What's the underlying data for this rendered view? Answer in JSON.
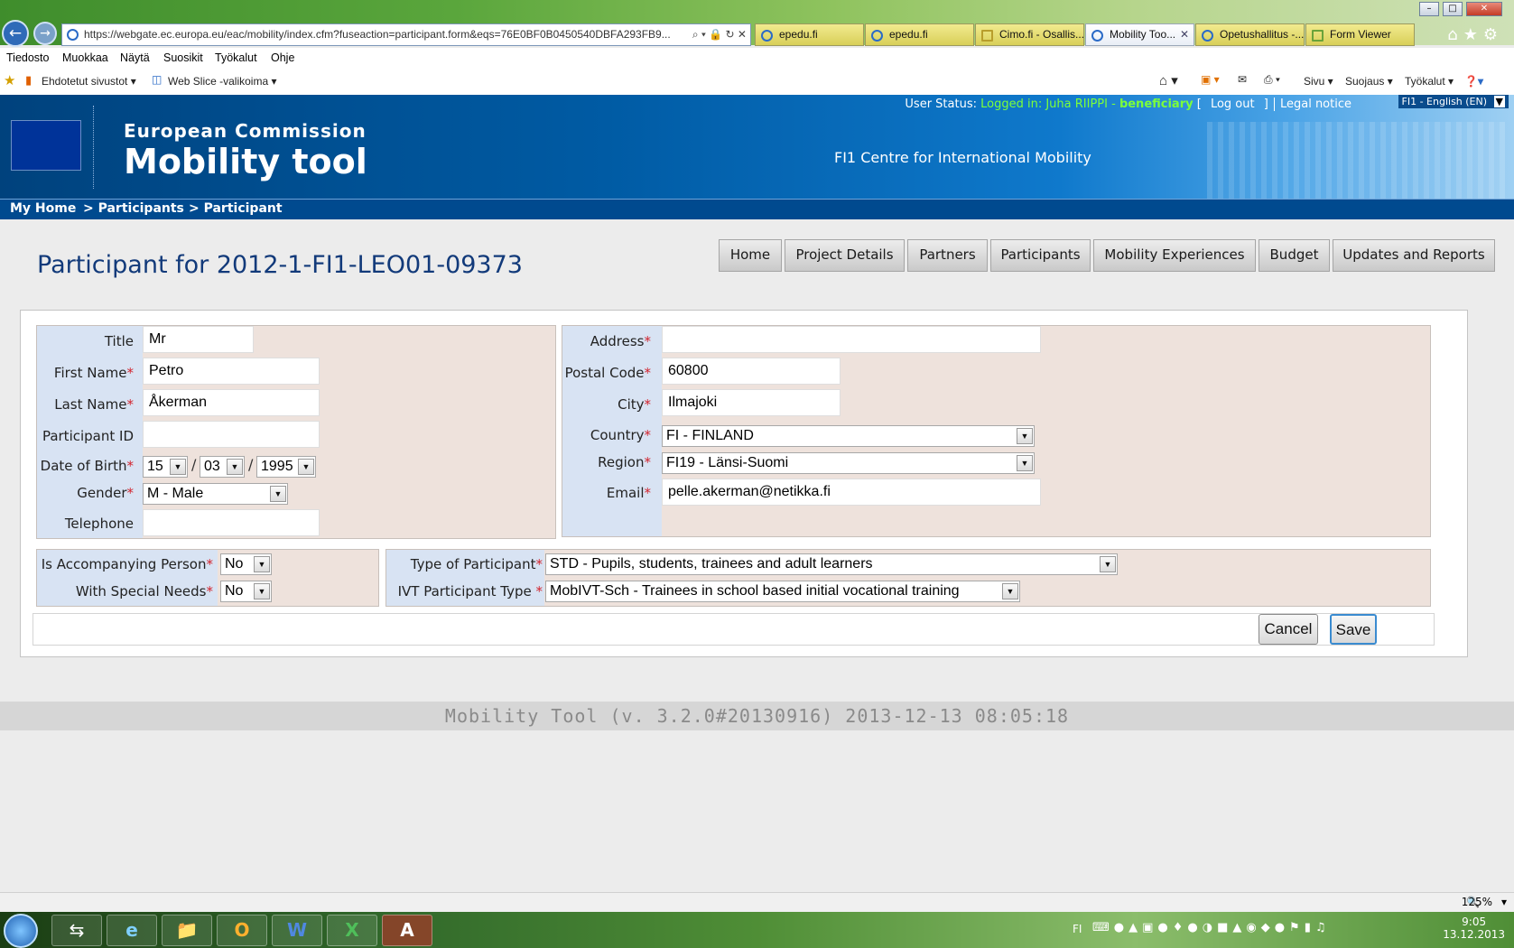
{
  "browser": {
    "url": "https://webgate.ec.europa.eu/eac/mobility/index.cfm?fuseaction=participant.form&eqs=76E0BF0B0450540DBFA293FB9...",
    "address_controls": "⌕ ▾ 🔒 ↻ ✕",
    "tabs": [
      {
        "label": "epedu.fi"
      },
      {
        "label": "epedu.fi"
      },
      {
        "label": "Cimo.fi - Osallis..."
      },
      {
        "label": "Mobility Too...",
        "close": "✕"
      },
      {
        "label": "Opetushallitus -..."
      },
      {
        "label": "Form Viewer"
      }
    ],
    "menu": [
      "Tiedosto",
      "Muokkaa",
      "Näytä",
      "Suosikit",
      "Työkalut",
      "Ohje"
    ],
    "favorites": {
      "item1": "Ehdotetut sivustot ▾",
      "item2": "Web Slice -valikoima ▾"
    },
    "command_bar": {
      "page": "Sivu ▾",
      "safety": "Suojaus ▾",
      "tools": "Työkalut ▾"
    },
    "zoom": "125%",
    "window_controls": {
      "minimize": "–",
      "maximize": "□",
      "close": "✕"
    }
  },
  "header": {
    "user_status_label": "User Status:",
    "logged_in_text": "Logged in: Juha RIIPPI -",
    "role": "beneficiary",
    "bracket_open": "[",
    "logout": "Log out",
    "bracket_close": "]",
    "legal_notice": "Legal notice",
    "language": "FI1 - English (EN)",
    "org_line1": "European Commission",
    "org_line2": "Mobility tool",
    "centre": "FI1 Centre for International Mobility"
  },
  "breadcrumb": [
    "My Home",
    "> Participants",
    "> Participant"
  ],
  "page_title": "Participant for 2012-1-FI1-LEO01-09373",
  "nav_tabs": [
    "Home",
    "Project Details",
    "Partners",
    "Participants",
    "Mobility Experiences",
    "Budget",
    "Updates and Reports"
  ],
  "form": {
    "required_marker": "*",
    "title": {
      "label": "Title",
      "value": "Mr"
    },
    "first_name": {
      "label": "First Name",
      "value": "Petro"
    },
    "last_name": {
      "label": "Last Name",
      "value": "Åkerman"
    },
    "participant_id": {
      "label": "Participant ID",
      "value": ""
    },
    "date_of_birth": {
      "label": "Date of Birth",
      "day": "15",
      "month": "03",
      "year": "1995",
      "separator": "/"
    },
    "gender": {
      "label": "Gender",
      "value": "M - Male"
    },
    "telephone": {
      "label": "Telephone",
      "value": ""
    },
    "address": {
      "label": "Address",
      "value": ""
    },
    "postal_code": {
      "label": "Postal Code",
      "value": "60800"
    },
    "city": {
      "label": "City",
      "value": "Ilmajoki"
    },
    "country": {
      "label": "Country",
      "value": "FI - FINLAND"
    },
    "region": {
      "label": "Region",
      "value": "FI19 - Länsi-Suomi"
    },
    "email": {
      "label": "Email",
      "value": "pelle.akerman@netikka.fi"
    },
    "accompanying": {
      "label": "Is Accompanying Person",
      "value": "No"
    },
    "special_needs": {
      "label": "With Special Needs",
      "value": "No"
    },
    "participant_type": {
      "label": "Type of Participant",
      "value": "STD - Pupils, students, trainees and adult learners"
    },
    "ivt_type": {
      "label": "IVT Participant Type",
      "value": "MobIVT-Sch - Trainees in school based initial vocational training"
    },
    "cancel": "Cancel",
    "save": "Save"
  },
  "footer": "Mobility Tool (v. 3.2.0#20130916) 2013-12-13 08:05:18",
  "taskbar": {
    "lang": "FI",
    "time": "9:05",
    "date": "13.12.2013"
  },
  "icons": [
    "back-icon",
    "forward-icon",
    "page-icon",
    "home-icon",
    "favorites-star-icon",
    "settings-gear-icon",
    "eu-flag-icon",
    "dropdown-arrow-icon",
    "windows-start-icon",
    "ie-icon",
    "explorer-icon",
    "outlook-icon",
    "word-icon",
    "excel-icon",
    "acrobat-icon"
  ],
  "colors": {
    "brand_blue": "#004a8f",
    "required": "#d2242e",
    "logged_in_green": "#7cff3a",
    "form_panel": "#eee2dc",
    "title_blue": "#123a7a"
  }
}
